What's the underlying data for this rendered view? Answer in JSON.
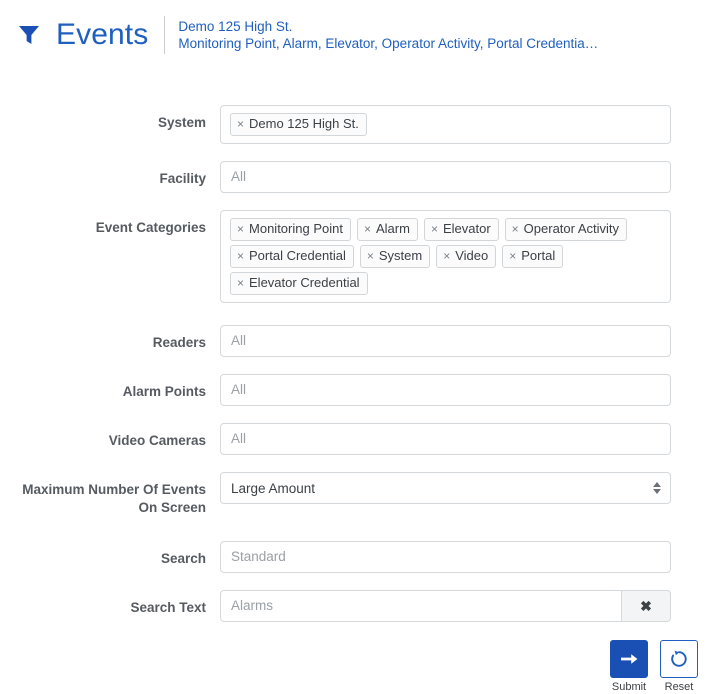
{
  "header": {
    "icon": "filter-funnel-icon",
    "title": "Events",
    "subtitle_line1": "Demo 125 High St.",
    "subtitle_line2": "Monitoring Point, Alarm, Elevator, Operator Activity, Portal Credentia…",
    "accent_color": "#1f5fbf"
  },
  "form": {
    "system": {
      "label": "System",
      "tokens": [
        "Demo 125 High St."
      ]
    },
    "facility": {
      "label": "Facility",
      "placeholder": "All",
      "value": ""
    },
    "event_categories": {
      "label": "Event Categories",
      "tokens": [
        "Monitoring Point",
        "Alarm",
        "Elevator",
        "Operator Activity",
        "Portal Credential",
        "System",
        "Video",
        "Portal",
        "Elevator Credential"
      ]
    },
    "readers": {
      "label": "Readers",
      "placeholder": "All",
      "value": ""
    },
    "alarm_points": {
      "label": "Alarm Points",
      "placeholder": "All",
      "value": ""
    },
    "video_cameras": {
      "label": "Video Cameras",
      "placeholder": "All",
      "value": ""
    },
    "max_events": {
      "label_line1": "Maximum Number Of Events",
      "label_line2": "On Screen",
      "selected": "Large Amount"
    },
    "search": {
      "label": "Search",
      "placeholder": "Standard",
      "value": ""
    },
    "search_text": {
      "label": "Search Text",
      "placeholder": "Alarms",
      "value": "",
      "clear_icon": "close-x-icon"
    }
  },
  "actions": {
    "submit": {
      "label": "Submit",
      "icon": "arrow-right-icon",
      "color": "#1a4fb4"
    },
    "reset": {
      "label": "Reset",
      "icon": "refresh-ccw-icon",
      "color": "#1f5fbf"
    }
  },
  "token_remove_glyph": "×"
}
